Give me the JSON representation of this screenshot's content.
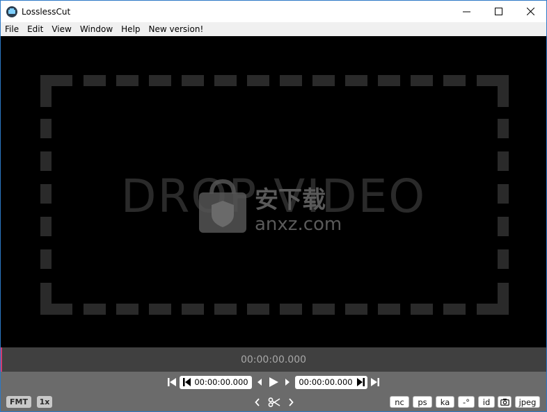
{
  "window": {
    "title": "LosslessCut"
  },
  "menu": [
    "File",
    "Edit",
    "View",
    "Window",
    "Help",
    "New version!"
  ],
  "drop_area": {
    "text": "DROP VIDEO"
  },
  "watermark": {
    "line1": "安下载",
    "line2": "anxz.com"
  },
  "timebar": {
    "current_time": "00:00:00.000"
  },
  "controls": {
    "cut_start_time": "00:00:00.000",
    "cut_end_time": "00:00:00.000",
    "fmt_label": "FMT",
    "speed_label": "1x",
    "nc_label": "nc",
    "ps_label": "ps",
    "ka_label": "ka",
    "rotate_label": "-°",
    "id_label": "id",
    "jpeg_label": "jpeg"
  },
  "icons": {
    "app": "losslesscut-icon",
    "minimize": "minimize-icon",
    "maximize": "maximize-icon",
    "close": "close-icon",
    "skip_start": "skip-to-start-icon",
    "skip_end": "skip-to-end-icon",
    "prev_frame": "step-back-icon",
    "next_frame": "step-forward-icon",
    "play": "play-icon",
    "scissors": "scissors-icon",
    "camera": "camera-icon"
  },
  "colors": {
    "accent": "#d23c70",
    "timebar_bg": "#404040",
    "controls_bg": "#6b6b6b"
  }
}
